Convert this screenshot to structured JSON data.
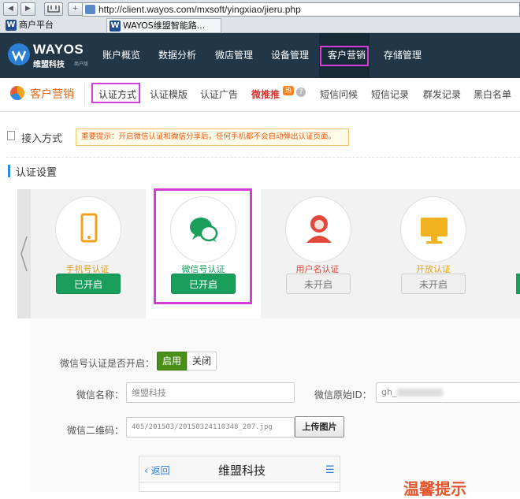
{
  "browser": {
    "address": "http://client.wayos.com/mxsoft/yingxiao/jieru.php",
    "back_glyph": "◀",
    "forward_glyph": "▶",
    "new_tab_glyph": "+",
    "tabs": [
      {
        "label": "商户平台"
      },
      {
        "label": "WAYOS维盟智能路..."
      }
    ]
  },
  "logo": {
    "brand": "WAYOS",
    "cn": "维盟科技",
    "sub": "商户版"
  },
  "topnav": {
    "items": [
      "账户概览",
      "数据分析",
      "微店管理",
      "设备管理",
      "客户营销",
      "存储管理"
    ],
    "active": "客户营销"
  },
  "subnav": {
    "section": "客户营销",
    "items": [
      "认证方式",
      "认证模版",
      "认证广告",
      "微推推",
      "短信问候",
      "短信记录",
      "群发记录",
      "黑白名单"
    ],
    "active": "认证方式",
    "hot_badge": "热"
  },
  "access": {
    "label": "接入方式",
    "tip": "重要提示：开启微信认证和微信分享后，任何手机都不会自动弹出认证页面。"
  },
  "auth_settings": {
    "title": "认证设置",
    "cards": [
      {
        "label": "手机号认证",
        "status": "已开启",
        "enabled": true,
        "icon": "phone-icon",
        "label_color": "#e89a1a"
      },
      {
        "label": "微信号认证",
        "status": "已开启",
        "enabled": true,
        "icon": "wechat-icon",
        "label_color": "#1a9e5c"
      },
      {
        "label": "用户名认证",
        "status": "未开启",
        "enabled": false,
        "icon": "user-icon",
        "label_color": "#e2483c"
      },
      {
        "label": "开放认证",
        "status": "未开启",
        "enabled": false,
        "icon": "monitor-icon",
        "label_color": "#e8a512"
      }
    ]
  },
  "wechat_form": {
    "enable_label": "微信号认证是否开启：",
    "enable_on": "启用",
    "enable_off": "关闭",
    "name_label": "微信名称：",
    "name_value": "维盟科技",
    "orig_id_label": "微信原始ID：",
    "orig_id_value": "gh_",
    "qr_label": "微信二维码：",
    "qr_path": "405/201503/20150324110348_207.jpg",
    "upload_button": "上传图片"
  },
  "preview": {
    "back": "返回",
    "title": "维盟科技",
    "side_text": "温馨提示"
  },
  "colors": {
    "nav_bg": "#213748",
    "highlight": "#d23dd6",
    "green": "#1a9e5c",
    "tip_text": "#e75b1e"
  }
}
